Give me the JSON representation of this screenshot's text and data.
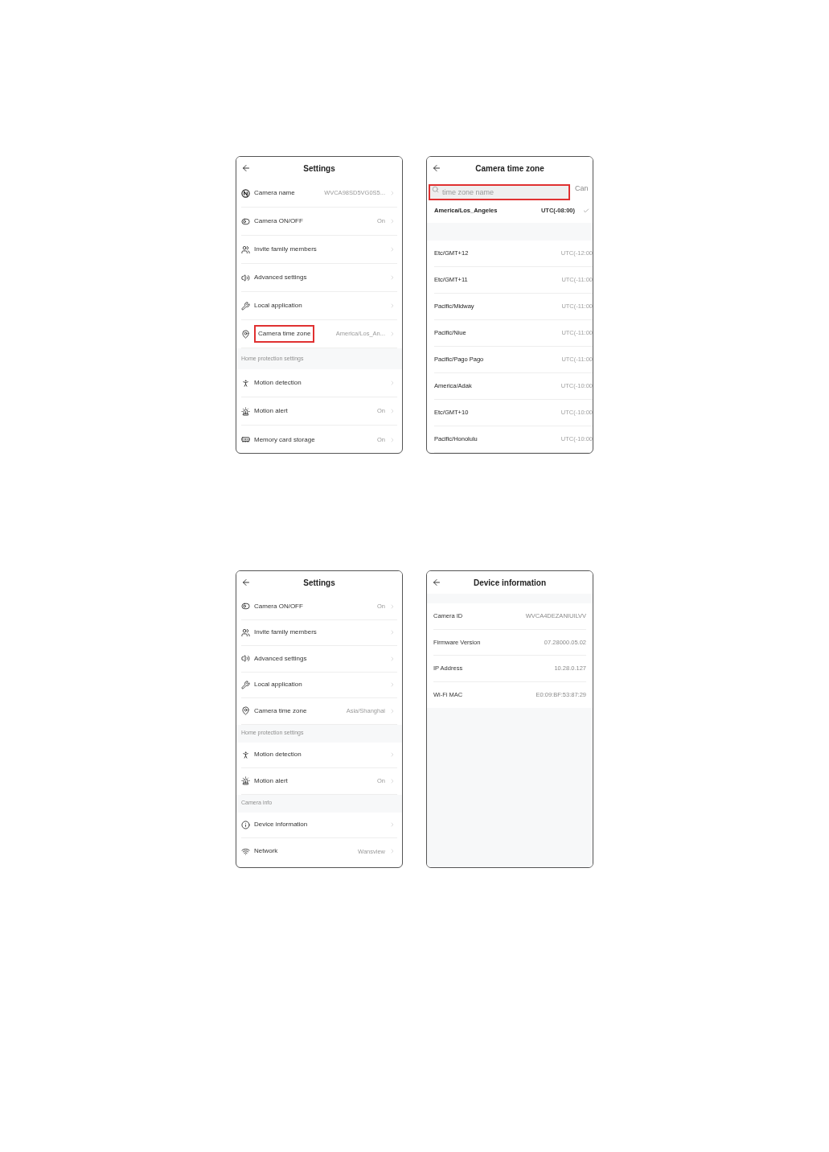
{
  "screens": [
    {
      "kind": "settings",
      "title": "Settings",
      "items": [
        {
          "kind": "name",
          "label": "Camera name",
          "value": "WVCA98SD5VG0S5...",
          "highlighted": false
        },
        {
          "kind": "power",
          "label": "Camera ON/OFF",
          "value": "On",
          "highlighted": false
        },
        {
          "kind": "invite",
          "label": "Invite family members",
          "highlighted": false
        },
        {
          "kind": "advanced",
          "label": "Advanced settings",
          "highlighted": false
        },
        {
          "kind": "local",
          "label": "Local application",
          "highlighted": false
        },
        {
          "kind": "timezone",
          "label": "Camera time zone",
          "value": "America/Los_An...",
          "highlighted": true
        },
        {
          "kind": "section",
          "label": "Home protection settings"
        },
        {
          "kind": "motion",
          "label": "Motion detection",
          "highlighted": false
        },
        {
          "kind": "alert",
          "label": "Motion alert",
          "value": "On",
          "highlighted": false
        },
        {
          "kind": "storage",
          "label": "Memory card storage",
          "value": "On",
          "highlighted": false
        }
      ]
    },
    {
      "kind": "timezones",
      "title": "Camera time zone",
      "search": {
        "placeholder": "time zone name",
        "highlighted": true
      },
      "cancel": "Can",
      "current": {
        "name": "America/Los_Angeles",
        "offset": "UTC(-08:00)",
        "selected": true
      },
      "zones": [
        {
          "name": "Etc/GMT+12",
          "offset": "UTC(-12:00",
          "selected": false
        },
        {
          "name": "Etc/GMT+11",
          "offset": "UTC(-11:00",
          "selected": false
        },
        {
          "name": "Pacific/Midway",
          "offset": "UTC(-11:00",
          "selected": false
        },
        {
          "name": "Pacific/Niue",
          "offset": "UTC(-11:00",
          "selected": false
        },
        {
          "name": "Pacific/Pago Pago",
          "offset": "UTC(-11:00",
          "selected": false
        },
        {
          "name": "America/Adak",
          "offset": "UTC(-10:00",
          "selected": false
        },
        {
          "name": "Etc/GMT+10",
          "offset": "UTC(-10:00",
          "selected": false
        },
        {
          "name": "Pacific/Honolulu",
          "offset": "UTC(-10:00",
          "selected": false
        }
      ]
    },
    {
      "kind": "settings",
      "title": "Settings",
      "items": [
        {
          "kind": "power",
          "label": "Camera ON/OFF",
          "value": "On",
          "highlighted": false
        },
        {
          "kind": "invite",
          "label": "Invite family members",
          "highlighted": false
        },
        {
          "kind": "advanced",
          "label": "Advanced settings",
          "highlighted": false
        },
        {
          "kind": "local",
          "label": "Local application",
          "highlighted": false
        },
        {
          "kind": "timezone",
          "label": "Camera time zone",
          "value": "Asia/Shanghai",
          "highlighted": false
        },
        {
          "kind": "section",
          "label": "Home protection settings"
        },
        {
          "kind": "motion",
          "label": "Motion detection",
          "highlighted": false
        },
        {
          "kind": "alert",
          "label": "Motion alert",
          "value": "On",
          "highlighted": false
        },
        {
          "kind": "section",
          "label": "Camera info"
        },
        {
          "kind": "info",
          "label": "Device information",
          "highlighted": false
        },
        {
          "kind": "network",
          "label": "Network",
          "value": "Wansview",
          "highlighted": false
        }
      ]
    },
    {
      "kind": "info",
      "title": "Device information",
      "rows": [
        {
          "label": "Camera ID",
          "value": "WVCA4DEZANIUILVV"
        },
        {
          "label": "Firmware Version",
          "value": "07.28000.05.02"
        },
        {
          "label": "IP Address",
          "value": "10.28.0.127"
        },
        {
          "label": "Wi-Fi MAC",
          "value": "E0:09:BF:53:87:29"
        }
      ]
    }
  ]
}
